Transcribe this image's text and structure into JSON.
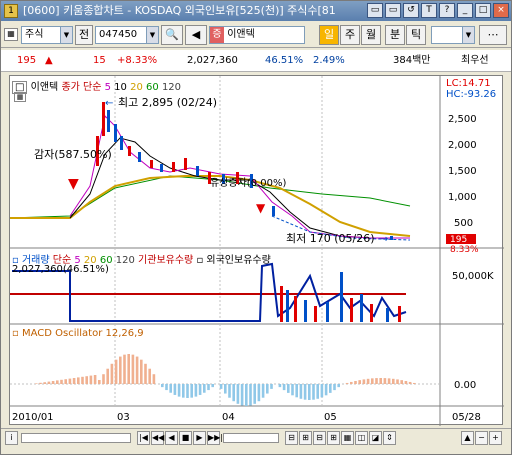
{
  "window": {
    "title": "[0600] 키움종합차트 - KOSDAQ 외국인보유[525(천)] 주식수[81",
    "controls": [
      "▭",
      "▭",
      "↺",
      "T",
      "?",
      "_",
      "□",
      "×"
    ]
  },
  "toolbar": {
    "market": "주식",
    "prev_label": "전",
    "code": "047450",
    "stock_badge": "증",
    "stock_name": "이앤텍",
    "period_buttons": [
      "일",
      "주",
      "월"
    ],
    "period_selected": "일",
    "min_label": "분",
    "tick_label": "틱"
  },
  "quote": {
    "price": "195",
    "change": "15",
    "change_pct": "+8.33%",
    "volume": "2,027,360",
    "foreign_ratio": "46.51%",
    "ratio2": "2.49%",
    "amount": "384백만",
    "hoga": "최우선"
  },
  "price_panel": {
    "legend_name": "이앤텍",
    "legend_ma": "종가 단순",
    "ma_periods": [
      "5",
      "10",
      "20",
      "60",
      "120"
    ],
    "lc_label": "LC:14.71",
    "hc_label": "HC:-93.26",
    "high_label": "최고 2,895 (02/24)",
    "low_label": "최저 170 (05/26)",
    "event_label1": "감자(587.50%)",
    "event_label2": "유상증자(0.00%)",
    "last_price_box": "195",
    "last_pct_box": "8.33%",
    "y_ticks": [
      "2,500",
      "2,000",
      "1,500",
      "1,000",
      "500"
    ]
  },
  "volume_panel": {
    "legend_vol": "거래량",
    "legend_ma": "단순",
    "ma_periods": [
      "5",
      "20",
      "60",
      "120"
    ],
    "legend_inst": "기관보유수량",
    "legend_foreign": "외국인보유수량",
    "last_label": "2,027,360",
    "last_pct": "(46.51%)",
    "y_tick": "50,000K"
  },
  "macd_panel": {
    "legend": "MACD Oscillator 12,26,9",
    "y_tick": "0.00"
  },
  "x_axis": {
    "labels": [
      "2010/01",
      "03",
      "04",
      "05",
      "05/28"
    ]
  },
  "colors": {
    "up": "#e00000",
    "down": "#0050c8",
    "ma5": "#c000c0",
    "ma10": "#000000",
    "ma20": "#d0a000",
    "ma60": "#009000",
    "ma120": "#404040"
  },
  "nav": {
    "buttons": [
      "|◀",
      "◀◀",
      "◀",
      "■",
      "▶",
      "▶▶|"
    ],
    "right_buttons": [
      "⊟",
      "⊞",
      "⊟",
      "⊞",
      "▦",
      "◫",
      "◪",
      "⇕",
      "▲",
      "−",
      "+"
    ]
  }
}
